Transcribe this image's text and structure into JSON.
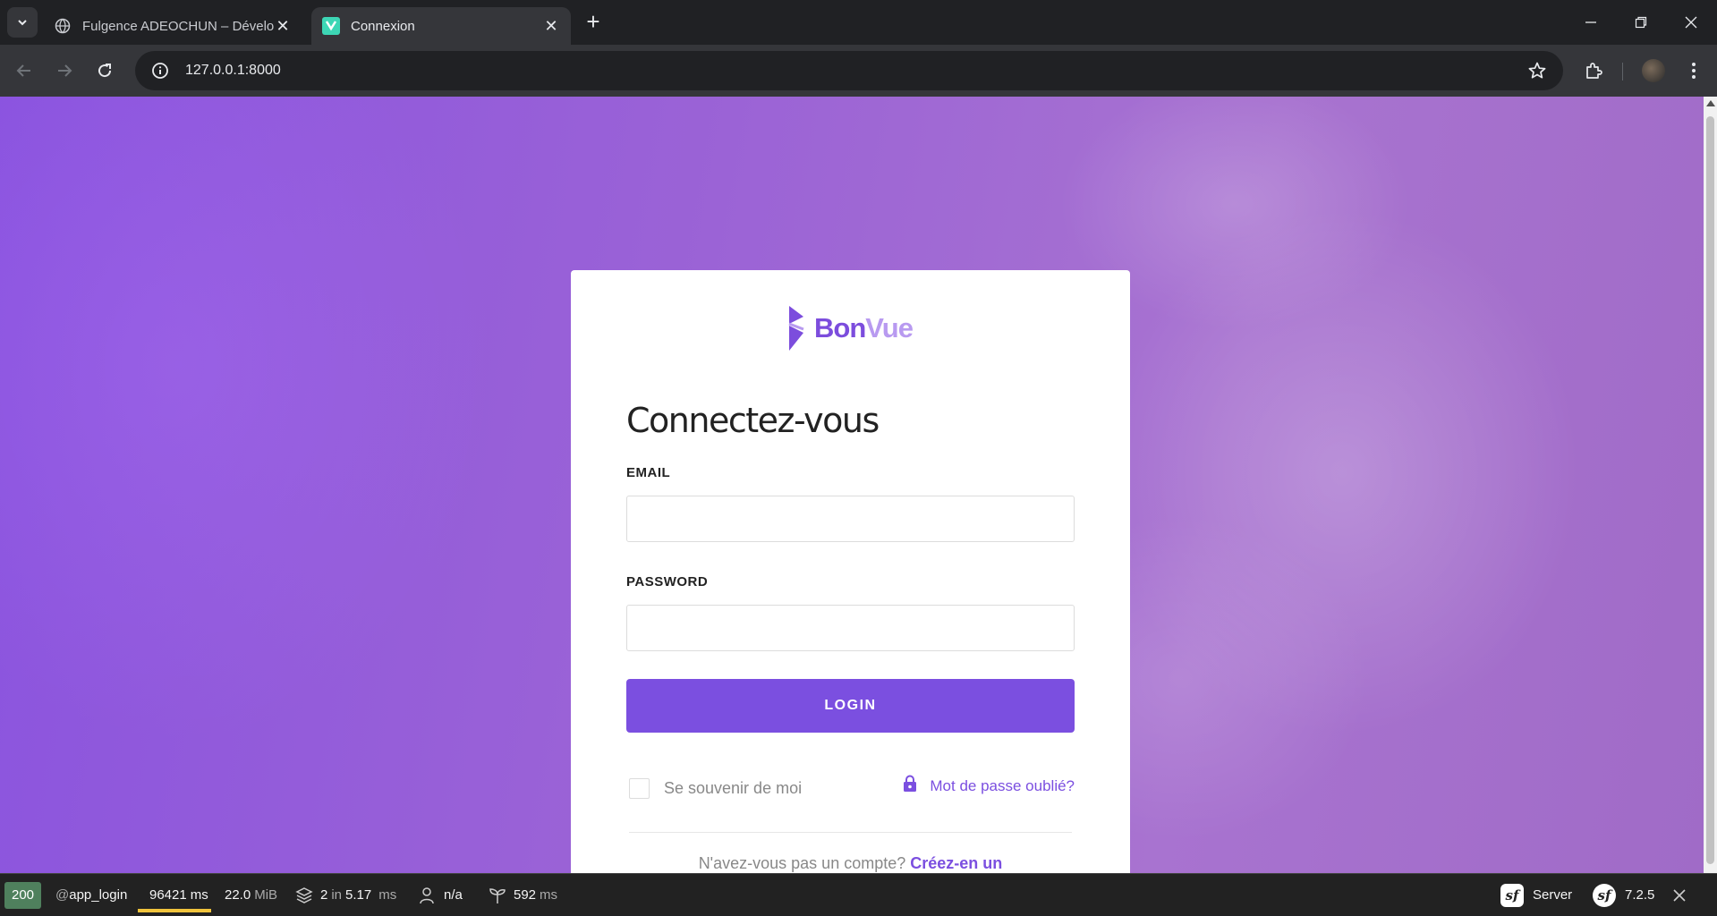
{
  "browser": {
    "tabs": [
      {
        "title": "Fulgence ADEOCHUN – Dévelo",
        "favicon": "globe-icon",
        "active": false
      },
      {
        "title": "Connexion",
        "favicon": "bonvue-favicon",
        "active": true
      }
    ],
    "url": "127.0.0.1:8000"
  },
  "login": {
    "brand_part1": "Bon",
    "brand_part2": "Vue",
    "heading": "Connectez-vous",
    "email_label": "EMAIL",
    "email_value": "",
    "password_label": "PASSWORD",
    "password_value": "",
    "login_button": "LOGIN",
    "remember_label": "Se souvenir de moi",
    "remember_checked": false,
    "forgot_label": "Mot de passe oublié?",
    "signup_prompt": "N'avez-vous pas un compte?",
    "signup_link": "Créez-en un"
  },
  "debugbar": {
    "status": "200",
    "route_prefix": "@",
    "route": "app_login",
    "time_value": "96421",
    "time_unit": "ms",
    "memory_value": "22.0",
    "memory_unit": "MiB",
    "twig_count": "2",
    "twig_in": "in",
    "twig_time": "5.17",
    "twig_unit": "ms",
    "user": "n/a",
    "ajax_value": "592",
    "ajax_unit": "ms",
    "server_label": "Server",
    "version": "7.2.5"
  },
  "colors": {
    "accent": "#7b4fe0",
    "status_ok": "#4f805d",
    "brand_light": "#b89af0"
  }
}
